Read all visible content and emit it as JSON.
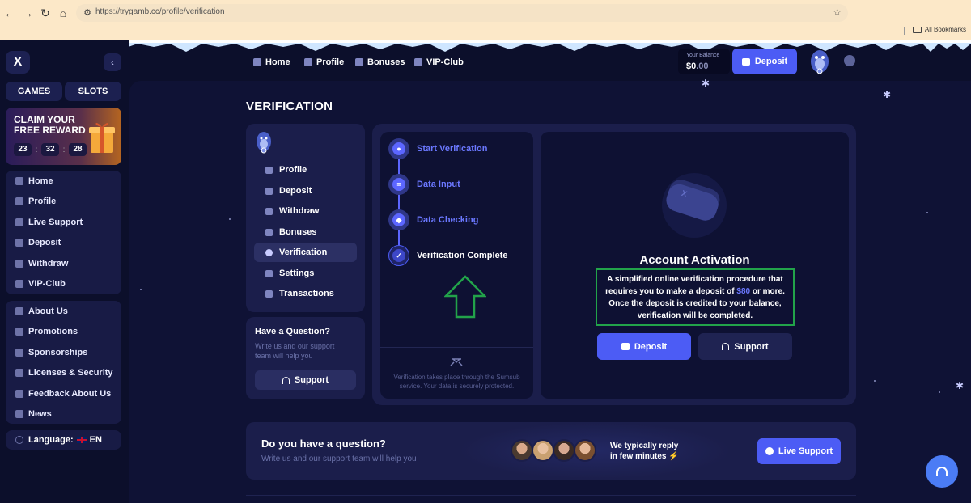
{
  "browser": {
    "url": "https://trygamb.cc/profile/verification",
    "bookmarks_label": "All Bookmarks"
  },
  "sidebar": {
    "logo": "X",
    "category_buttons": [
      "GAMES",
      "SLOTS"
    ],
    "reward": {
      "title": "CLAIM YOUR FREE REWARD",
      "timer": [
        "23",
        "32",
        "28"
      ]
    },
    "main_menu": [
      "Home",
      "Profile",
      "Live Support",
      "Deposit",
      "Withdraw",
      "VIP-Club"
    ],
    "info_menu": [
      "About Us",
      "Promotions",
      "Sponsorships",
      "Licenses & Security",
      "Feedback About Us",
      "News"
    ],
    "language": {
      "label": "Language:",
      "code": "EN"
    }
  },
  "topnav": {
    "items": [
      "Home",
      "Profile",
      "Bonuses",
      "VIP-Club"
    ],
    "balance_label": "Your Balance",
    "balance_main": "$0",
    "balance_cents": ".00",
    "deposit_label": "Deposit"
  },
  "page": {
    "title": "VERIFICATION",
    "profile_menu": [
      "Profile",
      "Deposit",
      "Withdraw",
      "Bonuses",
      "Verification",
      "Settings",
      "Transactions"
    ],
    "active_profile_item": "Verification",
    "question_card": {
      "title": "Have a Question?",
      "subtitle": "Write us and our support team will help you",
      "button": "Support"
    },
    "steps": [
      "Start Verification",
      "Data Input",
      "Data Checking",
      "Verification Complete"
    ],
    "sumsub_note": "Verification takes place through the Sumsub service. Your data is securely protected.",
    "activation": {
      "title": "Account Activation",
      "desc_part1": "A simplified online verification procedure that requires you to make a deposit of",
      "desc_amount": "$80",
      "desc_part2": "or more. Once the deposit is credited to your balance, verification will be completed.",
      "deposit_button": "Deposit",
      "support_button": "Support"
    },
    "banner": {
      "title": "Do you have a question?",
      "subtitle": "Write us and our support team will help you",
      "reply_line1": "We typically reply",
      "reply_line2": "in few minutes",
      "button": "Live Support"
    }
  },
  "colors": {
    "accent": "#4c5cf5",
    "link_blue": "#6b78ff",
    "highlight_border": "#22a34a",
    "background": "#0c0f2b"
  }
}
